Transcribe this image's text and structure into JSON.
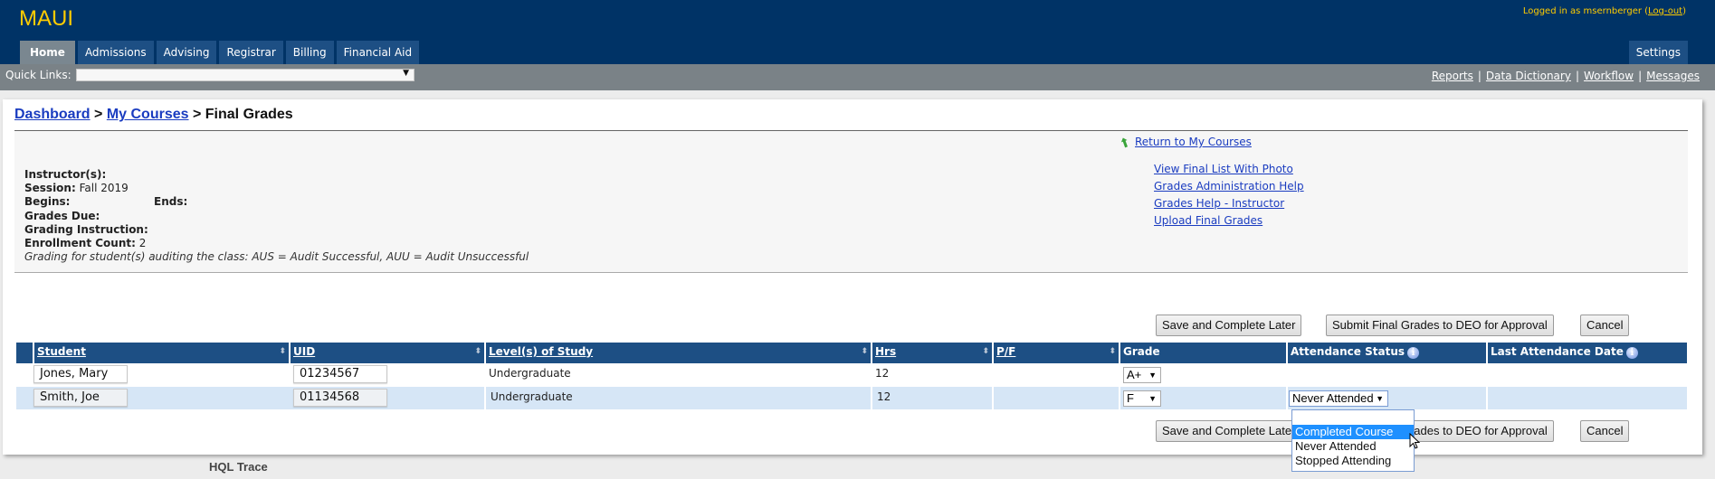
{
  "app": {
    "title": "MAUI"
  },
  "login": {
    "prefix": "Logged in as msernberger (",
    "logout": "Log-out",
    "suffix": ")"
  },
  "nav": {
    "tabs": [
      {
        "label": "Home",
        "active": true
      },
      {
        "label": "Admissions"
      },
      {
        "label": "Advising"
      },
      {
        "label": "Registrar"
      },
      {
        "label": "Billing"
      },
      {
        "label": "Financial Aid"
      }
    ],
    "settings": "Settings"
  },
  "quicklinks": {
    "label": "Quick Links:",
    "value": ""
  },
  "toplinks": [
    "Reports",
    "Data Dictionary",
    "Workflow",
    "Messages"
  ],
  "breadcrumb": {
    "items": [
      "Dashboard",
      "My Courses"
    ],
    "current": "Final Grades",
    "sep": ">"
  },
  "course_info": {
    "instructor_label": "Instructor(s):",
    "session_label": "Session:",
    "session_value": "Fall 2019",
    "begins_label": "Begins:",
    "ends_label": "Ends:",
    "grades_due_label": "Grades Due:",
    "grading_instruction_label": "Grading Instruction:",
    "enrollment_label": "Enrollment Count:",
    "enrollment_value": "2",
    "audit_note": "Grading for student(s) auditing the class: AUS = Audit Successful, AUU = Audit Unsuccessful"
  },
  "side_links": {
    "return": "Return to My Courses",
    "items": [
      "View Final List With Photo",
      "Grades Administration Help",
      "Grades Help - Instructor",
      "Upload Final Grades"
    ]
  },
  "buttons": {
    "save": "Save and Complete Later",
    "submit": "Submit Final Grades to DEO for Approval",
    "cancel": "Cancel"
  },
  "table": {
    "headers": [
      "Student",
      "UID",
      "Level(s) of Study",
      "Hrs",
      "P/F",
      "Grade",
      "Attendance Status",
      "Last Attendance Date"
    ],
    "rows": [
      {
        "student": "Jones, Mary",
        "uid": "01234567",
        "level": "Undergraduate",
        "hrs": "12",
        "pf": "",
        "grade": "A+",
        "attendance": "",
        "last_date": ""
      },
      {
        "student": "Smith, Joe",
        "uid": "01134568",
        "level": "Undergraduate",
        "hrs": "12",
        "pf": "",
        "grade": "F",
        "attendance": "Never Attended",
        "last_date": ""
      }
    ]
  },
  "attendance_dropdown": {
    "options": [
      "",
      "Completed Course",
      "Never Attended",
      "Stopped Attending"
    ],
    "highlighted": "Completed Course"
  },
  "footer": {
    "hql_trace": "HQL Trace"
  },
  "colors": {
    "header_bg": "#003366",
    "logo": "#ffcc00",
    "tab_bg": "#1d4f84",
    "table_header": "#1d4f84",
    "row_alt": "#d6e6f6",
    "highlight": "#1e90ff"
  }
}
